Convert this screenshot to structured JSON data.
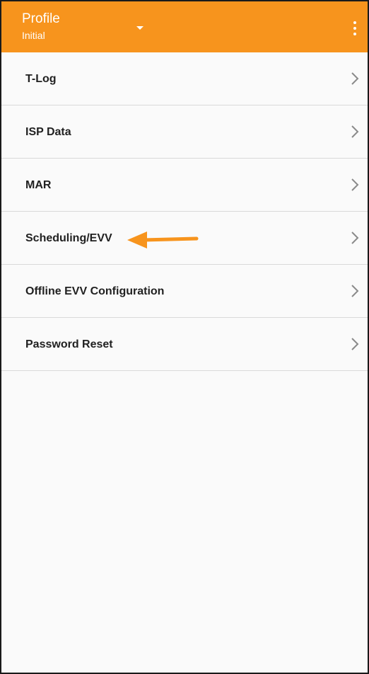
{
  "header": {
    "title": "Profile",
    "subtitle": "Initial",
    "dropdown_icon": "caret-down-icon",
    "menu_icon": "more-vert-icon",
    "background_color": "#f7941d"
  },
  "menu": {
    "items": [
      {
        "label": "T-Log"
      },
      {
        "label": "ISP Data"
      },
      {
        "label": "MAR"
      },
      {
        "label": "Scheduling/EVV"
      },
      {
        "label": "Offline EVV Configuration"
      },
      {
        "label": "Password Reset"
      }
    ],
    "chevron_icon": "chevron-right-icon"
  },
  "annotation": {
    "icon": "arrow-left-icon",
    "color": "#f7941d",
    "points_to": "Scheduling/EVV"
  }
}
